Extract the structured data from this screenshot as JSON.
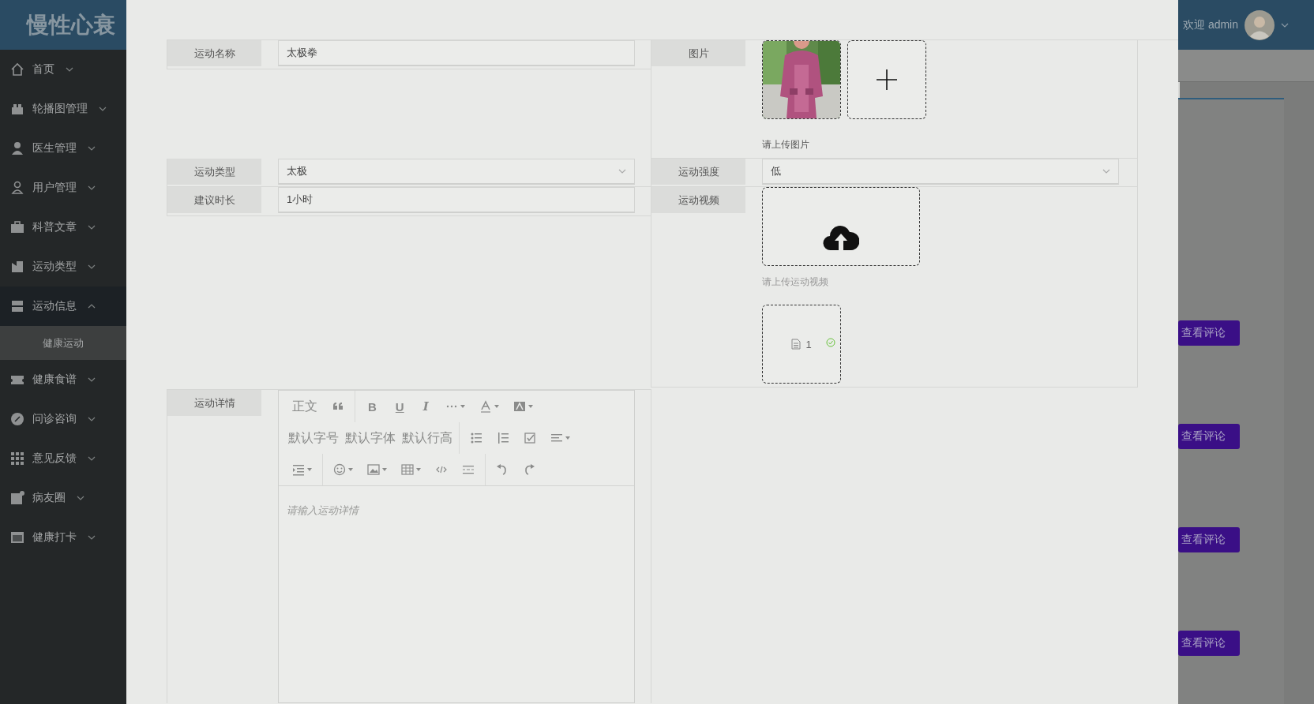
{
  "header": {
    "logo": "慢性心衰",
    "greeting": "欢迎 admin"
  },
  "sidebar": {
    "items": [
      {
        "label": "首页",
        "expanded": false
      },
      {
        "label": "轮播图管理",
        "expanded": false
      },
      {
        "label": "医生管理",
        "expanded": false
      },
      {
        "label": "用户管理",
        "expanded": false
      },
      {
        "label": "科普文章",
        "expanded": false
      },
      {
        "label": "运动类型",
        "expanded": false
      },
      {
        "label": "运动信息",
        "expanded": true,
        "children": [
          {
            "label": "健康运动",
            "selected": true
          }
        ]
      },
      {
        "label": "健康食谱",
        "expanded": false
      },
      {
        "label": "问诊咨询",
        "expanded": false
      },
      {
        "label": "意见反馈",
        "expanded": false
      },
      {
        "label": "病友圈",
        "expanded": false
      },
      {
        "label": "健康打卡",
        "expanded": false
      }
    ]
  },
  "form": {
    "name": {
      "label": "运动名称",
      "value": "太极拳"
    },
    "image": {
      "label": "图片",
      "hint": "请上传图片"
    },
    "type": {
      "label": "运动类型",
      "value": "太极"
    },
    "intensity": {
      "label": "运动强度",
      "value": "低"
    },
    "duration": {
      "label": "建议时长",
      "value": "1小时"
    },
    "video": {
      "label": "运动视频",
      "hint": "请上传运动视频",
      "file": "1",
      "uploaded": true
    },
    "details": {
      "label": "运动详情",
      "placeholder": "请输入运动详情",
      "heading": "正文",
      "format": [
        "B",
        "U",
        "I"
      ],
      "text_tools": [
        "默认字号",
        "默认字体",
        "默认行高"
      ]
    }
  },
  "background": {
    "buttons": [
      "查看评论",
      "查看评论",
      "查看评论",
      "查看评论"
    ]
  }
}
